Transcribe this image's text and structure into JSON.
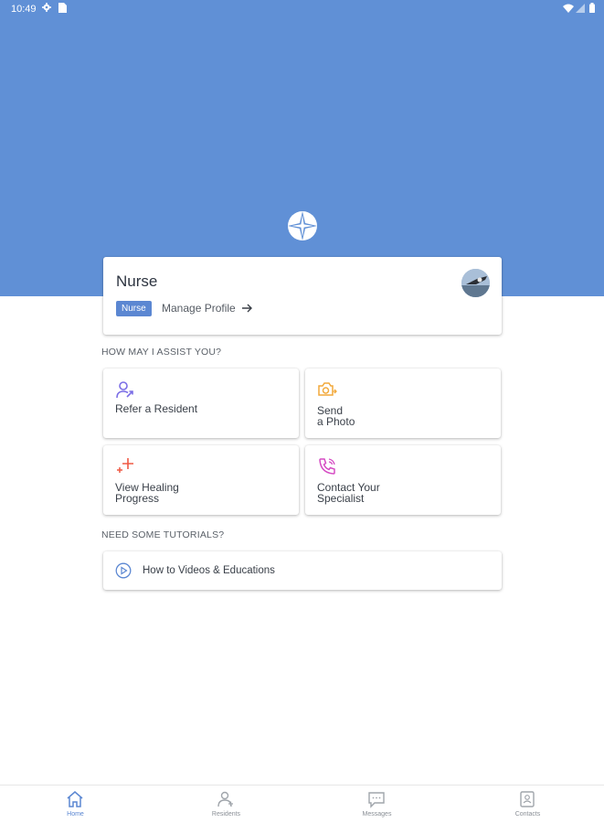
{
  "status_bar": {
    "time": "10:49"
  },
  "profile": {
    "name": "Nurse",
    "role": "Nurse",
    "manage_label": "Manage Profile"
  },
  "assist": {
    "title": "HOW MAY I ASSIST YOU?",
    "actions": [
      {
        "line1": "Refer a Resident",
        "line2": "",
        "icon": "refer-person-icon",
        "color": "#7b6ee6"
      },
      {
        "line1": "Send",
        "line2": "a Photo",
        "icon": "camera-icon",
        "color": "#f2a93b"
      },
      {
        "line1": "View Healing",
        "line2": "Progress",
        "icon": "sparkle-plus-icon",
        "color": "#ef5a45"
      },
      {
        "line1": "Contact Your",
        "line2": "Specialist",
        "icon": "phone-icon",
        "color": "#d54bc3"
      }
    ]
  },
  "tutorials": {
    "title": "NEED SOME TUTORIALS?",
    "item_label": "How to Videos & Educations"
  },
  "nav": {
    "items": [
      {
        "label": "Home",
        "icon": "home-icon",
        "active": true
      },
      {
        "label": "Residents",
        "icon": "residents-icon",
        "active": false
      },
      {
        "label": "Messages",
        "icon": "messages-icon",
        "active": false
      },
      {
        "label": "Contacts",
        "icon": "contacts-icon",
        "active": false
      }
    ]
  },
  "colors": {
    "header_blue": "#6090d6",
    "accent": "#5b87d2"
  }
}
